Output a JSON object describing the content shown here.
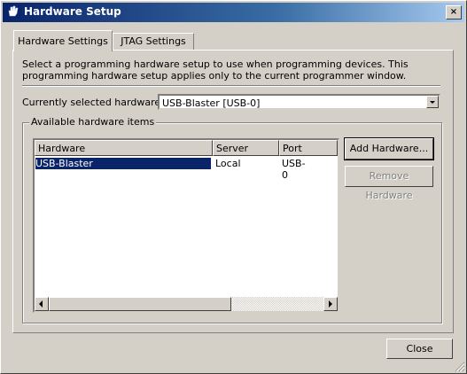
{
  "window": {
    "title": "Hardware Setup",
    "close_glyph": "×",
    "app_icon": "hand-icon"
  },
  "tabs": [
    {
      "label": "Hardware Settings",
      "active": true
    },
    {
      "label": "JTAG Settings",
      "active": false
    }
  ],
  "description": "Select a programming hardware setup to use when programming devices. This programming hardware setup applies only to the current programmer window.",
  "current_hardware": {
    "label": "Currently selected hardware:",
    "value": "USB-Blaster [USB-0]"
  },
  "available": {
    "legend": "Available hardware items",
    "columns": [
      "Hardware",
      "Server",
      "Port"
    ],
    "rows": [
      {
        "hardware": "USB-Blaster",
        "server": "Local",
        "port": "USB-0"
      }
    ]
  },
  "buttons": {
    "add": "Add Hardware...",
    "remove": "Remove Hardware",
    "close": "Close"
  },
  "colors": {
    "title_start": "#0a246a",
    "title_end": "#a6caf0",
    "selection": "#0a246a",
    "face": "#d4d0c8"
  }
}
